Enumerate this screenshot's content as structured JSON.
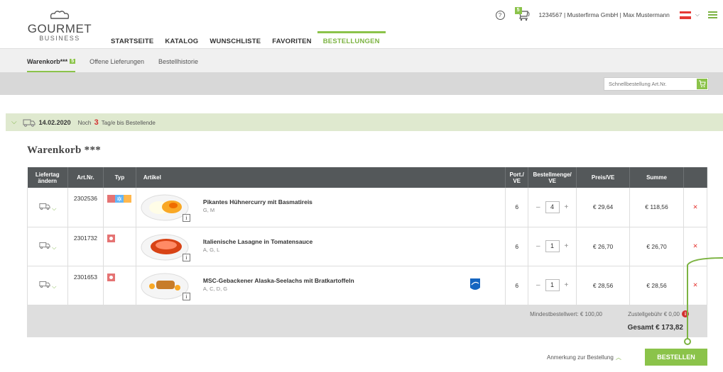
{
  "brand": {
    "title": "GOURMET",
    "subtitle": "BUSINESS"
  },
  "nav": [
    {
      "label": "STARTSEITE"
    },
    {
      "label": "KATALOG"
    },
    {
      "label": "WUNSCHLISTE"
    },
    {
      "label": "FAVORITEN"
    },
    {
      "label": "BESTELLUNGEN",
      "active": true
    }
  ],
  "header": {
    "cart_count": "5",
    "user": "1234567 | Musterfirma GmbH | Max Mustermann",
    "help": "?"
  },
  "subnav": {
    "cart_label": "Warenkorb***",
    "cart_badge": "5",
    "open_deliveries": "Offene Lieferungen",
    "history": "Bestellhistorie"
  },
  "quick_order": {
    "placeholder": "Schnellbestellung Art.Nr."
  },
  "delivery": {
    "date": "14.02.2020",
    "remaining_prefix": "Noch",
    "remaining_days": "3",
    "remaining_suffix": "Tag/e bis Bestellende"
  },
  "cart": {
    "title": "Warenkorb ***",
    "columns": {
      "change_day": "Liefertag ändern",
      "art_nr": "Art.Nr.",
      "type": "Typ",
      "article": "Artikel",
      "portions": "Port./ VE",
      "quantity": "Bestellmenge/ VE",
      "price": "Preis/VE",
      "sum": "Summe"
    },
    "rows": [
      {
        "art_nr": "2302536",
        "name": "Pikantes Hühnercurry mit Basmatireis",
        "allergens": "G, M",
        "portions": "6",
        "qty": "4",
        "price": "€ 29,64",
        "sum": "€ 118,56"
      },
      {
        "art_nr": "2301732",
        "name": "Italienische Lasagne in Tomatensauce",
        "allergens": "A, G, L",
        "portions": "6",
        "qty": "1",
        "price": "€ 26,70",
        "sum": "€ 26,70"
      },
      {
        "art_nr": "2301653",
        "name": "MSC-Gebackener Alaska-Seelachs mit Bratkartoffeln",
        "allergens": "A, C, D, G",
        "portions": "6",
        "qty": "1",
        "price": "€ 28,56",
        "sum": "€ 28,56"
      }
    ],
    "min_order": "Mindestbestellwert: € 100,00",
    "delivery_fee": "Zustellgebühr € 0,00",
    "total": "Gesamt € 173,82"
  },
  "actions": {
    "note": "Anmerkung zur Bestellung",
    "order": "BESTELLEN"
  },
  "colors": {
    "accent": "#8bc34a",
    "header_dark": "#54585a",
    "alert": "#d32f2f"
  }
}
